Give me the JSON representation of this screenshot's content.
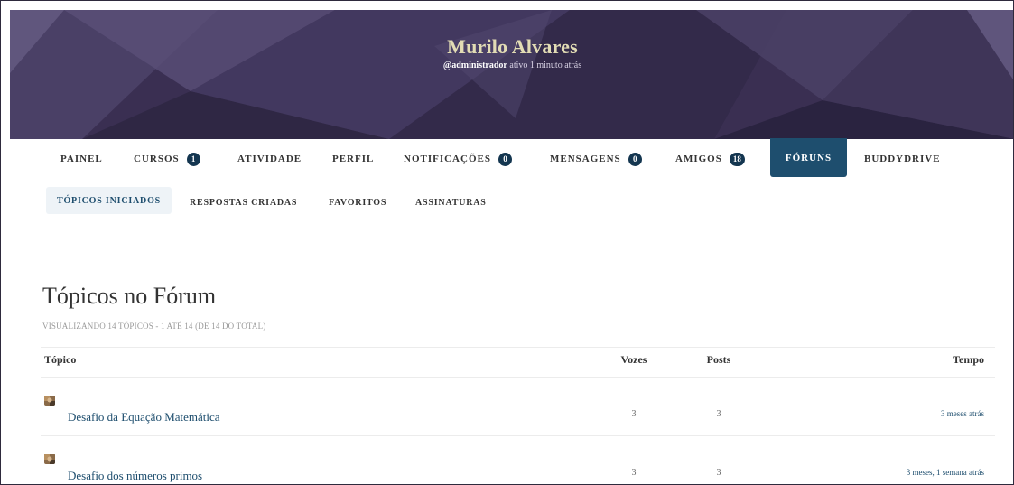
{
  "profile": {
    "name": "Murilo Alvares",
    "handle": "@administrador",
    "activity": "ativo 1 minuto atrás"
  },
  "nav": {
    "items": [
      {
        "label": "PAINEL",
        "badge": null
      },
      {
        "label": "CURSOS",
        "badge": "1"
      },
      {
        "label": "ATIVIDADE",
        "badge": null
      },
      {
        "label": "PERFIL",
        "badge": null
      },
      {
        "label": "NOTIFICAÇÕES",
        "badge": "0"
      },
      {
        "label": "MENSAGENS",
        "badge": "0"
      },
      {
        "label": "AMIGOS",
        "badge": "18"
      },
      {
        "label": "FÓRUNS",
        "badge": null,
        "active": true
      },
      {
        "label": "BUDDYDRIVE",
        "badge": null
      }
    ]
  },
  "subnav": {
    "items": [
      {
        "label": "TÓPICOS INICIADOS",
        "active": true
      },
      {
        "label": "RESPOSTAS CRIADAS"
      },
      {
        "label": "FAVORITOS"
      },
      {
        "label": "ASSINATURAS"
      }
    ]
  },
  "content": {
    "title": "Tópicos no Fórum",
    "viewing": "VISUALIZANDO 14 TÓPICOS - 1 ATÉ 14 (DE 14 DO TOTAL)",
    "columns": {
      "topic": "Tópico",
      "voices": "Vozes",
      "posts": "Posts",
      "time": "Tempo"
    },
    "rows": [
      {
        "title": "Desafio da Equação Matemática",
        "voices": "3",
        "posts": "3",
        "time": "3 meses atrás"
      },
      {
        "title": "Desafio dos números primos",
        "voices": "3",
        "posts": "3",
        "time": "3 meses, 1 semana atrás"
      }
    ]
  },
  "colors": {
    "accent": "#1e4e6e",
    "badge": "#143650",
    "cover": "#3a2f52",
    "name": "#e2dcb4"
  }
}
